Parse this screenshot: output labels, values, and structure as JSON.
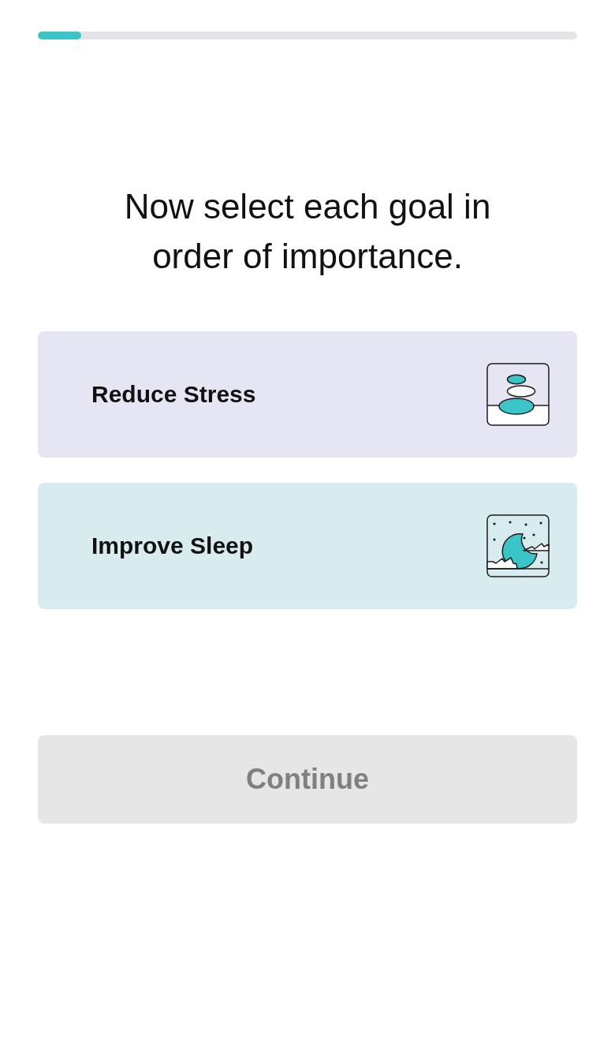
{
  "progress": {
    "level": 0.08
  },
  "heading": "Now select each goal in order of importance.",
  "goals": [
    {
      "label": "Reduce Stress",
      "kind": "stones",
      "color": "#e6e5f3",
      "selected": false
    },
    {
      "label": "Improve Sleep",
      "kind": "moon",
      "color": "#d8ebef",
      "selected": false
    }
  ],
  "continue_button": {
    "label": "Continue",
    "disabled": true
  }
}
